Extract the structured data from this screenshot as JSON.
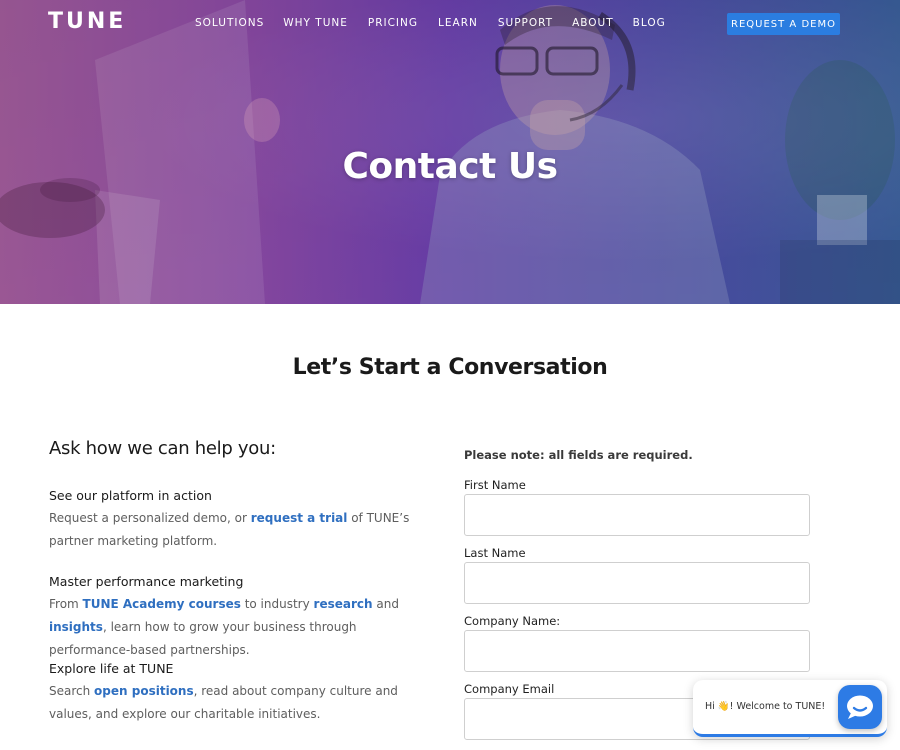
{
  "header": {
    "logo": "TUNE",
    "nav": [
      "SOLUTIONS",
      "WHY TUNE",
      "PRICING",
      "LEARN",
      "SUPPORT",
      "ABOUT",
      "BLOG"
    ],
    "cta": "REQUEST A DEMO"
  },
  "hero": {
    "title": "Contact Us"
  },
  "main": {
    "title": "Let’s Start a Conversation",
    "left": {
      "heading": "Ask how we can help you:",
      "items": [
        {
          "title": "See our platform in action",
          "t1": "Request a personalized demo, or ",
          "l1": "request a trial",
          "t2": " of TUNE’s partner marketing platform."
        },
        {
          "title": "Master performance marketing",
          "t1": "From ",
          "l1": "TUNE Academy courses",
          "t2": " to industry ",
          "l2": "research",
          "t3": " and ",
          "l3": "insights",
          "t4": ", learn how to grow your business through performance-based partnerships."
        },
        {
          "title": "Explore life at TUNE",
          "t1": "Search ",
          "l1": "open positions",
          "t2": ", read about company culture and values, and explore our charitable initiatives."
        }
      ]
    },
    "form": {
      "note": "Please note: all fields are required.",
      "fields": [
        {
          "label": "First Name",
          "value": ""
        },
        {
          "label": "Last Name",
          "value": ""
        },
        {
          "label": "Company Name:",
          "value": ""
        },
        {
          "label": "Company Email",
          "value": ""
        }
      ]
    }
  },
  "chat": {
    "greeting_pre": "Hi ",
    "emoji": "👋",
    "greeting_post": "! Welcome to TUNE!",
    "icon": "chat-bubble-icon"
  },
  "colors": {
    "accent": "#2b7de0",
    "link": "#2f6fc0",
    "hero_left": "#a25c9c",
    "hero_right": "#3a5f9c"
  }
}
